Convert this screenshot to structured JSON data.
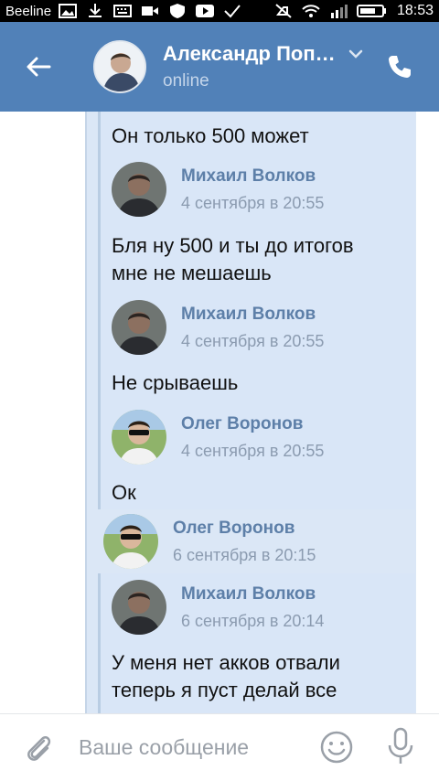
{
  "status_bar": {
    "carrier": "Beeline",
    "time": "18:53",
    "icons": [
      "image-icon",
      "download-icon",
      "keyboard-icon",
      "video-icon",
      "shield-icon",
      "youtube-icon",
      "check-icon",
      "mute-icon",
      "wifi-icon",
      "signal-icon",
      "battery-icon"
    ]
  },
  "header": {
    "title": "Александр Поп…",
    "status": "online",
    "colors": {
      "background": "#5181b8",
      "status_text": "#c4d5ea"
    }
  },
  "messages": [
    {
      "text": "Он только 500 может"
    },
    {
      "author": "Михаил Волков",
      "date": "4 сентября в 20:55",
      "text": "Бля ну 500 и ты до итогов\nмне не мешаешь"
    },
    {
      "author": "Михаил Волков",
      "date": "4 сентября в 20:55",
      "text": "Не срываешь"
    },
    {
      "author": "Олег Воронов",
      "date": "4 сентября в 20:55",
      "text": "Ок"
    },
    {
      "author": "Олег Воронов",
      "date": "6 сентября в 20:15",
      "text": ""
    },
    {
      "author": "Михаил Волков",
      "date": "6 сентября в 20:14",
      "text": "У меня нет акков отвали\nтеперь я пуст делай все"
    }
  ],
  "composer": {
    "placeholder": "Ваше сообщение",
    "value": ""
  }
}
